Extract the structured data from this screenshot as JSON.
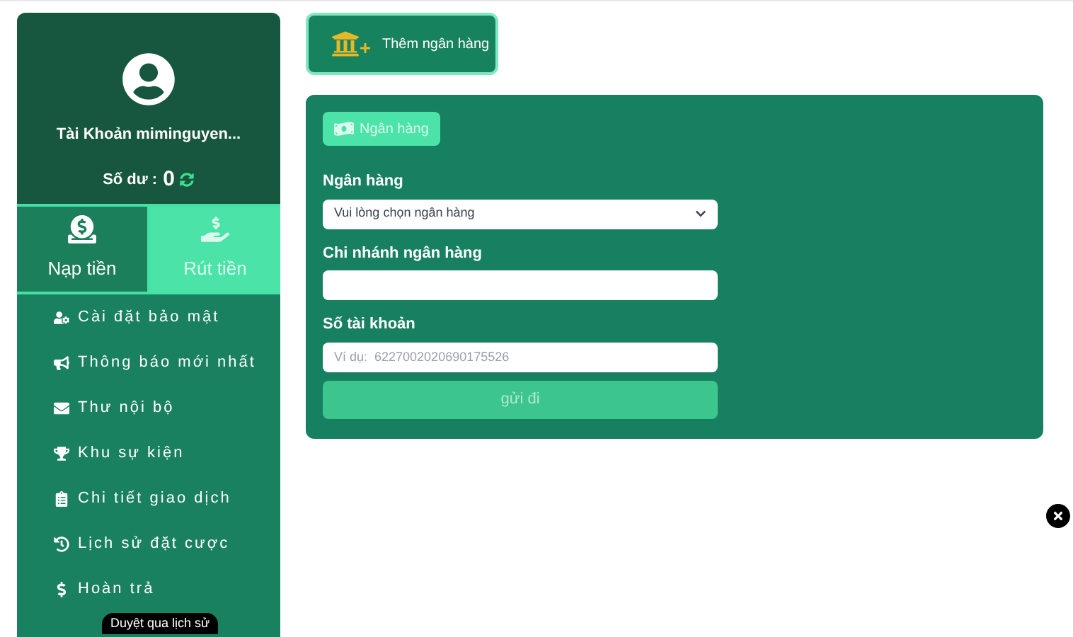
{
  "account": {
    "name": "Tài Khoản miminguyen...",
    "balance_label": "Số dư :",
    "balance": "0"
  },
  "actions": [
    {
      "kind": "deposit",
      "label": "Nạp tiền",
      "selected": false
    },
    {
      "kind": "withdraw",
      "label": "Rút tiền",
      "selected": true
    }
  ],
  "menu": [
    {
      "kind": "security",
      "label": "Cài đặt bảo mật"
    },
    {
      "kind": "notice",
      "label": "Thông báo mới nhất"
    },
    {
      "kind": "mail",
      "label": "Thư nội bộ"
    },
    {
      "kind": "event",
      "label": "Khu sự kiện"
    },
    {
      "kind": "transactions",
      "label": "Chi tiết giao dịch"
    },
    {
      "kind": "history",
      "label": "Lịch sử đặt cược"
    },
    {
      "kind": "refund",
      "label": "Hoàn trả"
    }
  ],
  "tooltip": "Duyệt qua lịch sử",
  "add_bank_button": "Thêm ngân hàng",
  "form": {
    "tab": "Ngân hàng",
    "fields": [
      {
        "kind": "select",
        "label": "Ngân hàng",
        "value": "Vui lòng chọn ngân hàng"
      },
      {
        "kind": "text",
        "label": "Chi nhánh ngân hàng"
      },
      {
        "kind": "text",
        "label": "Số tài khoản",
        "placeholder": "Ví dụ:  6227002020690175526"
      }
    ],
    "submit": "gửi đi"
  }
}
